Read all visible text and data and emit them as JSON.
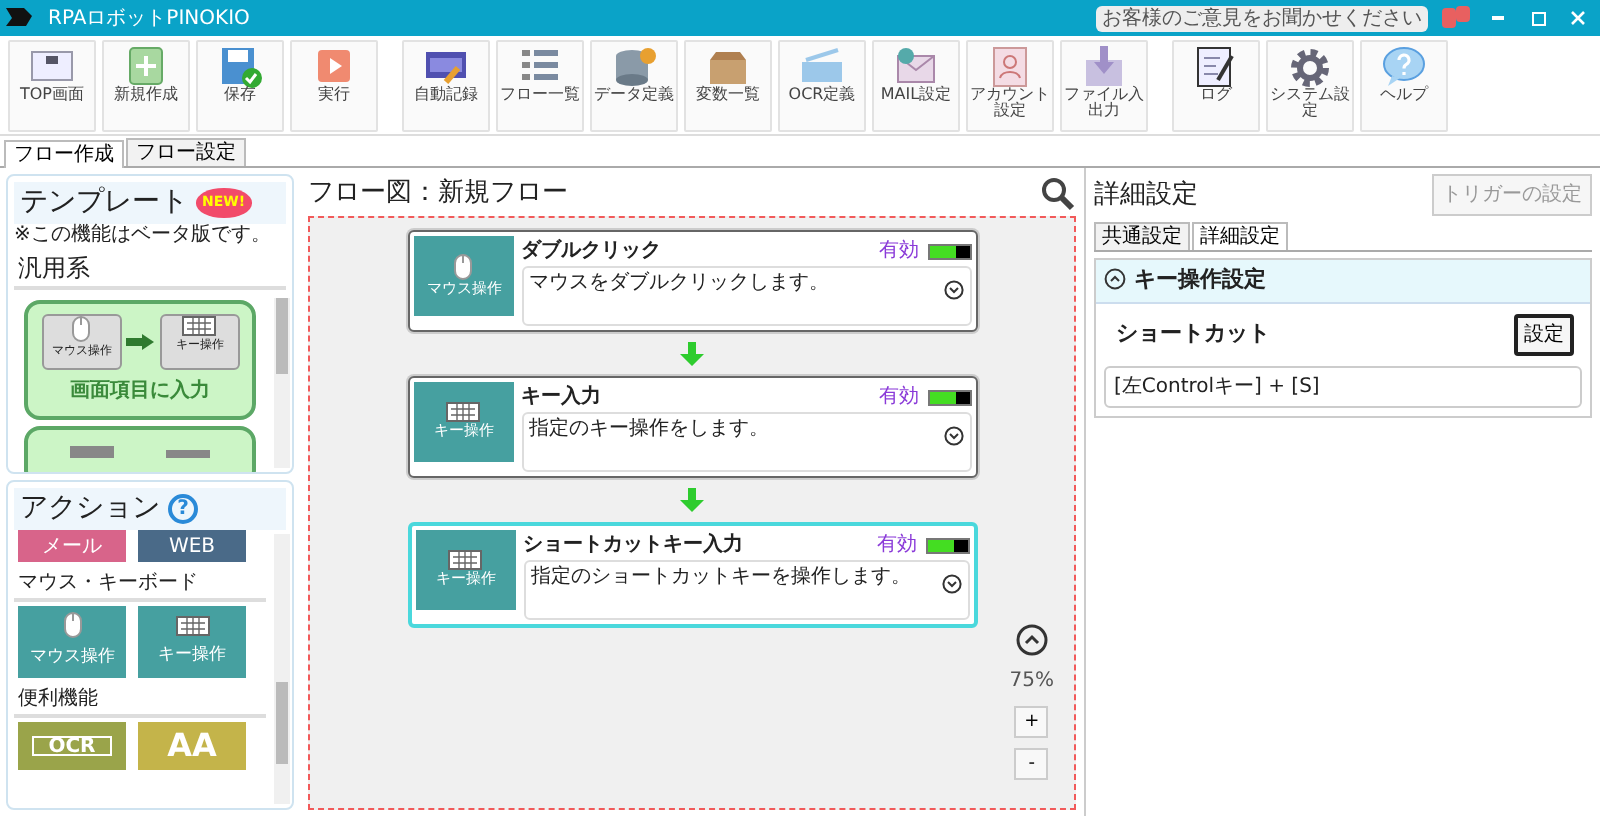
{
  "window": {
    "title": "RPAロボットPINOKIO",
    "feedback": "お客様のご意見をお聞かせください"
  },
  "toolbar_groups": [
    {
      "buttons": [
        {
          "label": "TOP画面",
          "kind": "top"
        },
        {
          "label": "新規作成",
          "kind": "new"
        },
        {
          "label": "保存",
          "kind": "save"
        },
        {
          "label": "実行",
          "kind": "run"
        }
      ]
    },
    {
      "buttons": [
        {
          "label": "自動記録",
          "kind": "record"
        },
        {
          "label": "フロー一覧",
          "kind": "list"
        },
        {
          "label": "データ定義",
          "kind": "data"
        },
        {
          "label": "変数一覧",
          "kind": "box"
        },
        {
          "label": "OCR定義",
          "kind": "ocr"
        },
        {
          "label": "MAIL設定",
          "kind": "mail"
        },
        {
          "label": "アカウント設定",
          "kind": "account"
        },
        {
          "label": "ファイル入出力",
          "kind": "file"
        }
      ]
    },
    {
      "buttons": [
        {
          "label": "ログ",
          "kind": "log"
        },
        {
          "label": "システム設定",
          "kind": "gear"
        },
        {
          "label": "ヘルプ",
          "kind": "help"
        }
      ]
    }
  ],
  "tabs": [
    {
      "label": "フロー作成",
      "selected": true
    },
    {
      "label": "フロー設定",
      "selected": false
    }
  ],
  "templates": {
    "title": "テンプレート",
    "badge": "NEW!",
    "note": "※この機能はベータ版です。",
    "category": "汎用系",
    "items": [
      {
        "kind": "mouse_to_key",
        "label": "画面項目に入力",
        "from_label": "マウス操作",
        "to_label": "キー操作"
      },
      {
        "kind": "partial"
      }
    ]
  },
  "actions": {
    "title": "アクション",
    "help": "?",
    "sections": [
      {
        "tiles": [
          {
            "label": "メール",
            "kind": "mail"
          },
          {
            "label": "WEB",
            "kind": "web"
          }
        ]
      },
      {
        "heading": "マウス・キーボード",
        "tiles": [
          {
            "label": "マウス操作",
            "kind": "mouse"
          },
          {
            "label": "キー操作",
            "kind": "key"
          }
        ]
      },
      {
        "heading": "便利機能",
        "tiles": [
          {
            "label": "OCR",
            "kind": "ocr"
          },
          {
            "label": "AA",
            "kind": "font"
          }
        ]
      }
    ]
  },
  "flow": {
    "title": "フロー図：新規フロー",
    "zoom": "75%",
    "zoom_in": "+",
    "zoom_out": "-",
    "nodes": [
      {
        "kind": "mouse",
        "icon_label": "マウス操作",
        "title": "ダブルクリック",
        "description": "マウスをダブルクリックします。",
        "status": "有効",
        "enabled": true,
        "selected": false
      },
      {
        "kind": "key",
        "icon_label": "キー操作",
        "title": "キー入力",
        "description": "指定のキー操作をします。",
        "status": "有効",
        "enabled": true,
        "selected": false
      },
      {
        "kind": "key",
        "icon_label": "キー操作",
        "title": "ショートカットキー入力",
        "description": "指定のショートカットキーを操作します。",
        "status": "有効",
        "enabled": true,
        "selected": true
      }
    ]
  },
  "details": {
    "title": "詳細設定",
    "trigger_button": "トリガーの設定",
    "trigger_disabled": true,
    "tabs": [
      {
        "label": "共通設定",
        "selected": false
      },
      {
        "label": "詳細設定",
        "selected": true
      }
    ],
    "section": {
      "title": "キー操作設定",
      "expanded": true,
      "field_label": "ショートカット",
      "set_button": "設定",
      "value": "[左Controlキー] + [S]"
    }
  }
}
